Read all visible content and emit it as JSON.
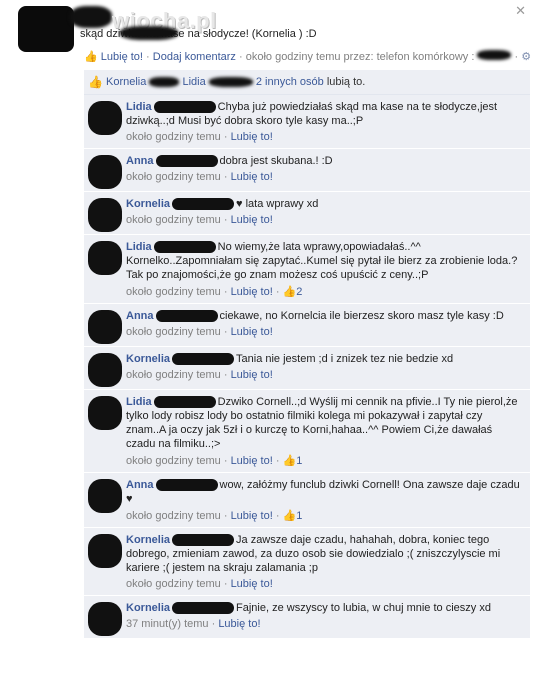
{
  "window": {
    "close_glyph": "✕"
  },
  "post": {
    "watermark": "wiocha.pl",
    "text": "skąd dziwka ma kase na słodycze! (Kornelia ) :D",
    "actions": {
      "like": "Lubię to!",
      "comment": "Dodaj komentarz",
      "time": "około godziny temu przez: telefon komórkowy",
      "sep": "·"
    }
  },
  "likes": {
    "name1": "Kornelia",
    "name2": "Lidia",
    "others": "2 innych osób",
    "suffix": "lubią to."
  },
  "comments": [
    {
      "name": "Lidia",
      "text": "Chyba już powiedziałaś skąd ma kase na te słodycze,jest dziwką..;d Musi być dobra skoro tyle kasy ma..;P",
      "time": "około godziny temu",
      "like": "Lubię to!",
      "likes": ""
    },
    {
      "name": "Anna",
      "text": "dobra jest skubana.! :D",
      "time": "około godziny temu",
      "like": "Lubię to!",
      "likes": ""
    },
    {
      "name": "Kornelia",
      "text": "♥ lata wprawy xd",
      "time": "około godziny temu",
      "like": "Lubię to!",
      "likes": ""
    },
    {
      "name": "Lidia",
      "text": "No wiemy,że lata wprawy,opowiadałaś..^^ Kornelko..Zapomniałam się zapytać..Kumel się pytał ile bierz za zrobienie loda.? Tak po znajomości,że go znam możesz coś upuścić z ceny..;P",
      "time": "około godziny temu",
      "like": "Lubię to!",
      "likes": "2"
    },
    {
      "name": "Anna",
      "text": "ciekawe, no Kornelcia ile bierzesz skoro masz tyle kasy :D",
      "time": "około godziny temu",
      "like": "Lubię to!",
      "likes": ""
    },
    {
      "name": "Kornelia",
      "text": "Tania nie jestem ;d i znizek tez nie bedzie xd",
      "time": "około godziny temu",
      "like": "Lubię to!",
      "likes": ""
    },
    {
      "name": "Lidia",
      "text": "Dzwiko Cornell..;d Wyślij mi cennik na pfivie..I Ty nie pierol,że tylko lody robisz lody bo ostatnio filmiki kolega mi pokazywał i zapytał czy znam..A ja oczy jak 5zł i o kurczę to Korni,hahaa..^^ Powiem Ci,że dawałaś czadu na filmiku..;>",
      "time": "około godziny temu",
      "like": "Lubię to!",
      "likes": "1"
    },
    {
      "name": "Anna",
      "text": "wow, załóżmy funclub dziwki Cornell! Ona zawsze daje czadu ♥",
      "time": "około godziny temu",
      "like": "Lubię to!",
      "likes": "1"
    },
    {
      "name": "Kornelia",
      "text": "Ja zawsze daje czadu, hahahah, dobra, koniec tego dobrego, zmieniam zawod, za duzo osob sie dowiedzialo ;( zniszczylyscie mi kariere ;( jestem na skraju zalamania ;p",
      "time": "około godziny temu",
      "like": "Lubię to!",
      "likes": ""
    },
    {
      "name": "Kornelia",
      "text": "Fajnie, ze wszyscy to lubia, w chuj mnie to cieszy xd",
      "time": "37 minut(y) temu",
      "like": "Lubię to!",
      "likes": ""
    }
  ]
}
